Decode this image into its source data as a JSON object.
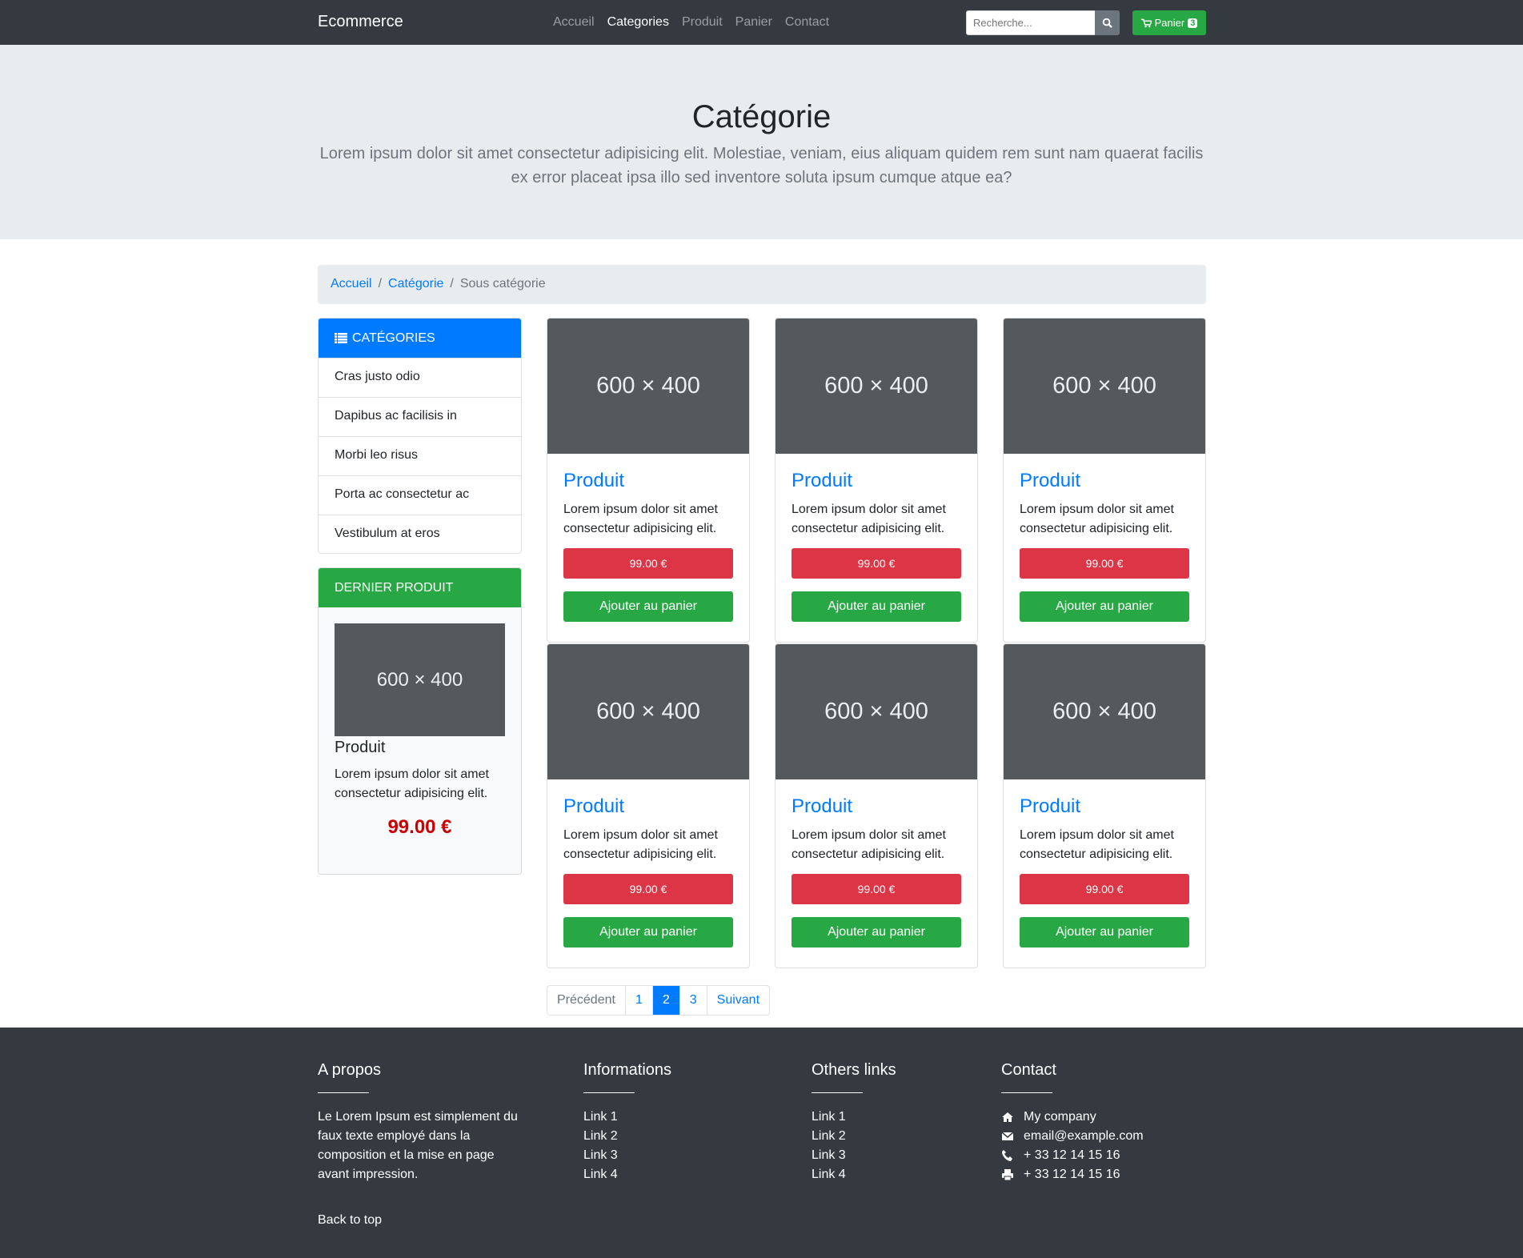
{
  "nav": {
    "brand": "Ecommerce",
    "links": [
      "Accueil",
      "Categories",
      "Produit",
      "Panier",
      "Contact"
    ],
    "active": 1,
    "search_placeholder": "Recherche...",
    "cart_label": "Panier",
    "cart_count": "3"
  },
  "hero": {
    "title": "Catégorie",
    "lead": "Lorem ipsum dolor sit amet consectetur adipisicing elit. Molestiae, veniam, eius aliquam quidem rem sunt nam quaerat facilis ex error placeat ipsa illo sed inventore soluta ipsum cumque atque ea?"
  },
  "breadcrumb": {
    "items": [
      "Accueil",
      "Catégorie"
    ],
    "current": "Sous catégorie"
  },
  "sidebar": {
    "categories_title": "CATÉGORIES",
    "categories": [
      "Cras justo odio",
      "Dapibus ac facilisis in",
      "Morbi leo risus",
      "Porta ac consectetur ac",
      "Vestibulum at eros"
    ],
    "latest_title": "DERNIER PRODUIT",
    "latest": {
      "image": "600 × 400",
      "name": "Produit",
      "desc": "Lorem ipsum dolor sit amet consectetur adipisicing elit.",
      "price": "99.00 €"
    }
  },
  "products": [
    {
      "image": "600 × 400",
      "name": "Produit",
      "desc": "Lorem ipsum dolor sit amet consectetur adipisicing elit.",
      "price": "99.00 €",
      "cta": "Ajouter au panier"
    },
    {
      "image": "600 × 400",
      "name": "Produit",
      "desc": "Lorem ipsum dolor sit amet consectetur adipisicing elit.",
      "price": "99.00 €",
      "cta": "Ajouter au panier"
    },
    {
      "image": "600 × 400",
      "name": "Produit",
      "desc": "Lorem ipsum dolor sit amet consectetur adipisicing elit.",
      "price": "99.00 €",
      "cta": "Ajouter au panier"
    },
    {
      "image": "600 × 400",
      "name": "Produit",
      "desc": "Lorem ipsum dolor sit amet consectetur adipisicing elit.",
      "price": "99.00 €",
      "cta": "Ajouter au panier"
    },
    {
      "image": "600 × 400",
      "name": "Produit",
      "desc": "Lorem ipsum dolor sit amet consectetur adipisicing elit.",
      "price": "99.00 €",
      "cta": "Ajouter au panier"
    },
    {
      "image": "600 × 400",
      "name": "Produit",
      "desc": "Lorem ipsum dolor sit amet consectetur adipisicing elit.",
      "price": "99.00 €",
      "cta": "Ajouter au panier"
    }
  ],
  "pagination": {
    "prev": "Précédent",
    "pages": [
      "1",
      "2",
      "3"
    ],
    "current": "2",
    "next": "Suivant"
  },
  "footer": {
    "about_title": "A propos",
    "about_text": "Le Lorem Ipsum est simplement du faux texte employé dans la composition et la mise en page avant impression.",
    "back_to_top": "Back to top",
    "info_title": "Informations",
    "info_links": [
      "Link 1",
      "Link 2",
      "Link 3",
      "Link 4"
    ],
    "others_title": "Others links",
    "others_links": [
      "Link 1",
      "Link 2",
      "Link 3",
      "Link 4"
    ],
    "contact_title": "Contact",
    "company": "My company",
    "email": "email@example.com",
    "phone": "+ 33 12 14 15 16",
    "fax": "+ 33 12 14 15 16"
  },
  "colors": {
    "primary": "#007bff",
    "success": "#28a745",
    "danger": "#dc3545",
    "dark": "#343a40"
  }
}
